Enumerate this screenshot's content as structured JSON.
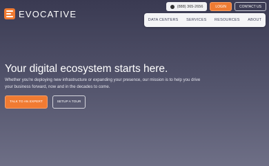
{
  "brand": {
    "name": "EVOCATIVE",
    "accent_color": "#f07b32"
  },
  "topbar": {
    "phone": "(888) 365-2656",
    "login_label": "LOGIN",
    "contact_label": "CONTACT US"
  },
  "nav": {
    "items": [
      {
        "label": "DATA CENTERS"
      },
      {
        "label": "SERVICES"
      },
      {
        "label": "RESOURCES"
      },
      {
        "label": "ABOUT"
      }
    ]
  },
  "hero": {
    "title": "Your digital ecosystem starts here.",
    "subtitle": "Whether you're deploying new infrastructure or expanding your presence, our mission is to help you drive your business forward, now and in the decades to come.",
    "primary_cta": "TALK TO AN EXPERT",
    "secondary_cta": "SETUP A TOUR"
  }
}
